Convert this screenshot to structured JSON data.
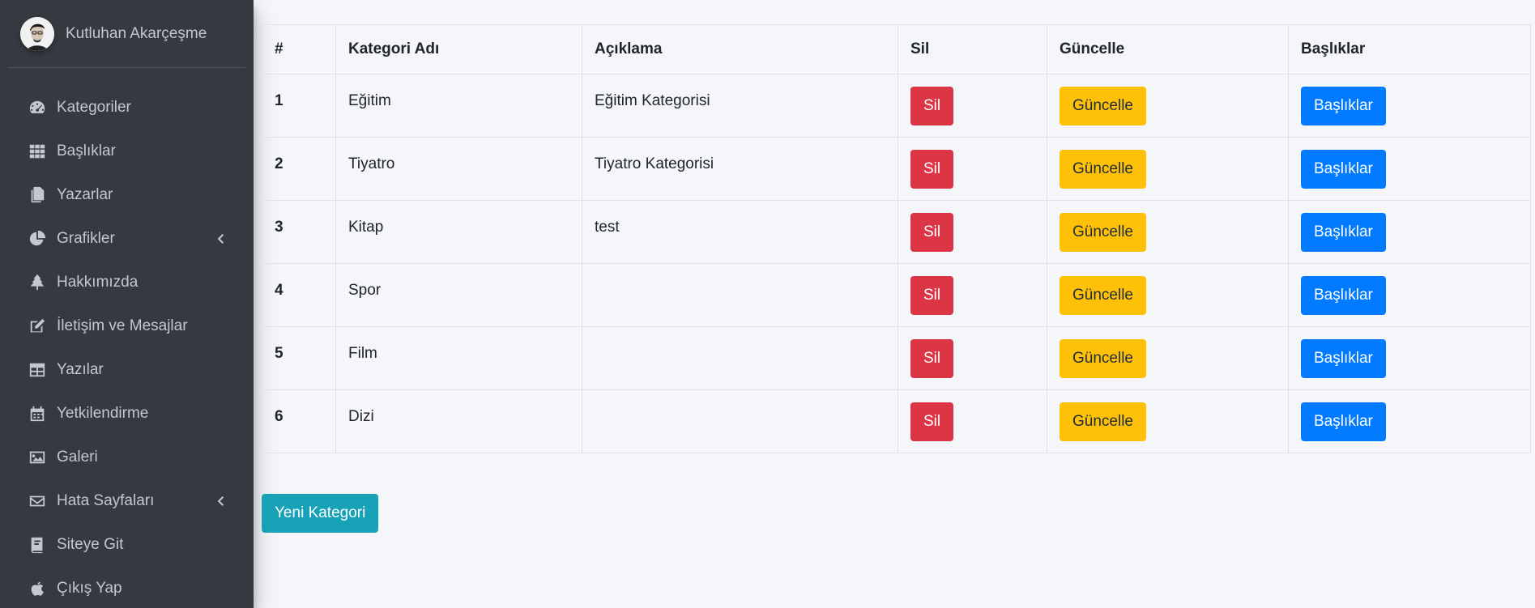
{
  "user": {
    "name": "Kutluhan Akarçeşme"
  },
  "sidebar": {
    "items": [
      {
        "label": "Kategoriler",
        "icon": "tachometer-icon",
        "arrow": false
      },
      {
        "label": "Başlıklar",
        "icon": "grid-icon",
        "arrow": false
      },
      {
        "label": "Yazarlar",
        "icon": "copy-icon",
        "arrow": false
      },
      {
        "label": "Grafikler",
        "icon": "pie-chart-icon",
        "arrow": true
      },
      {
        "label": "Hakkımızda",
        "icon": "tree-icon",
        "arrow": false
      },
      {
        "label": "İletişim ve Mesajlar",
        "icon": "edit-icon",
        "arrow": false
      },
      {
        "label": "Yazılar",
        "icon": "table-icon",
        "arrow": false
      },
      {
        "label": "Yetkilendirme",
        "icon": "calendar-icon",
        "arrow": false
      },
      {
        "label": "Galeri",
        "icon": "image-icon",
        "arrow": false
      },
      {
        "label": "Hata Sayfaları",
        "icon": "envelope-icon",
        "arrow": true
      },
      {
        "label": "Siteye Git",
        "icon": "book-icon",
        "arrow": false
      },
      {
        "label": "Çıkış Yap",
        "icon": "apple-icon",
        "arrow": false
      }
    ]
  },
  "table": {
    "headers": [
      "#",
      "Kategori Adı",
      "Açıklama",
      "Sil",
      "Güncelle",
      "Başlıklar"
    ],
    "rows": [
      {
        "id": "1",
        "name": "Eğitim",
        "description": "Eğitim Kategorisi"
      },
      {
        "id": "2",
        "name": "Tiyatro",
        "description": "Tiyatro Kategorisi"
      },
      {
        "id": "3",
        "name": "Kitap",
        "description": "test"
      },
      {
        "id": "4",
        "name": "Spor",
        "description": ""
      },
      {
        "id": "5",
        "name": "Film",
        "description": ""
      },
      {
        "id": "6",
        "name": "Dizi",
        "description": ""
      }
    ],
    "delete_label": "Sil",
    "update_label": "Güncelle",
    "titles_label": "Başlıklar"
  },
  "new_category_label": "Yeni Kategori",
  "colors": {
    "sidebar_bg": "#343a40",
    "danger": "#dc3545",
    "warning": "#ffc107",
    "primary": "#007bff",
    "info": "#17a2b8",
    "page_bg": "#f4f6f9"
  }
}
